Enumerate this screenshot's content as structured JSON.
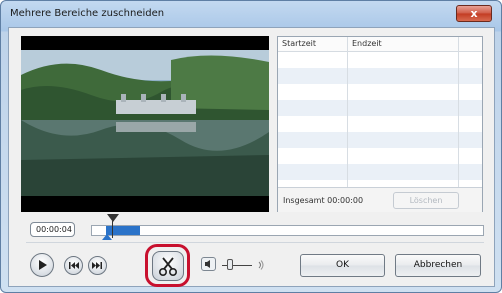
{
  "window": {
    "title": "Mehrere Bereiche zuschneiden",
    "close_label": "x"
  },
  "table": {
    "columns": [
      "Startzeit",
      "Endzeit"
    ],
    "rows": [],
    "total_label": "Insgesamt 00:00:00",
    "delete_label": "Löschen"
  },
  "timeline": {
    "current_time": "00:00:04"
  },
  "buttons": {
    "ok": "OK",
    "cancel": "Abbrechen"
  },
  "colors": {
    "selection": "#2b73c9",
    "highlight": "#c8102e"
  }
}
